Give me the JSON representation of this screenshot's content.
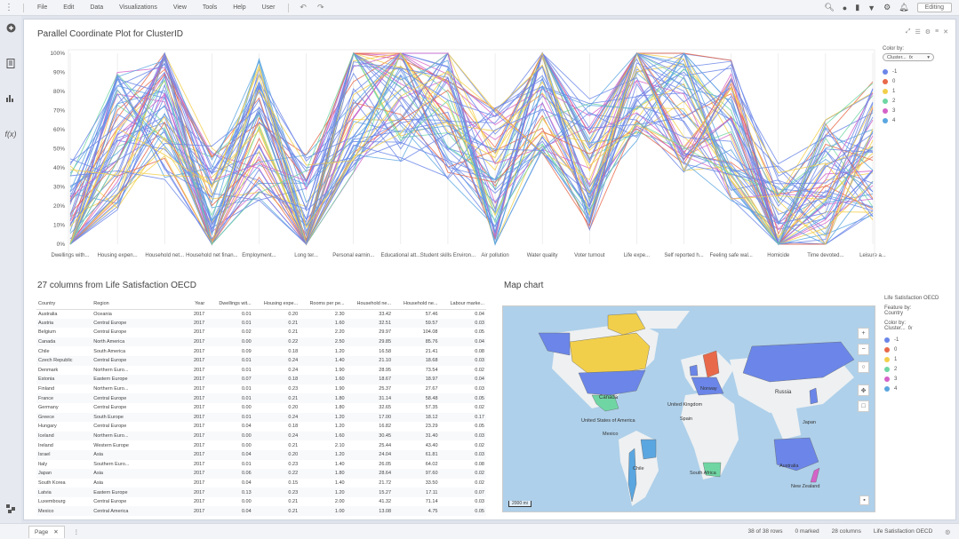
{
  "menubar": {
    "items": [
      "File",
      "Edit",
      "Data",
      "Visualizations",
      "View",
      "Tools",
      "Help",
      "User"
    ],
    "editing_label": "Editing"
  },
  "parallel_plot": {
    "title": "Parallel Coordinate Plot for ClusterID",
    "y_ticks": [
      "100%",
      "90%",
      "80%",
      "70%",
      "60%",
      "50%",
      "40%",
      "30%",
      "20%",
      "10%",
      "0%"
    ],
    "axes": [
      "Dwellings with...",
      "Housing expen...",
      "Household net...",
      "Household net finan...",
      "Employment...",
      "Long ter...",
      "Personal earnin...",
      "Educational att...",
      "Student skills Environ...",
      "Air pollution",
      "Water quality",
      "Voter turnout",
      "Life expe...",
      "Self reported h...",
      "Feeling safe wal...",
      "Homicide",
      "Time devoted...",
      "Leisure a..."
    ],
    "color_by_label": "Color by:",
    "color_by_value": "Cluster...",
    "color_by_fx": "fx",
    "legend": [
      {
        "label": "-1",
        "color": "#6b86e8"
      },
      {
        "label": "0",
        "color": "#e8684a"
      },
      {
        "label": "1",
        "color": "#f2cf4a"
      },
      {
        "label": "2",
        "color": "#6fd6a3"
      },
      {
        "label": "3",
        "color": "#d463c8"
      },
      {
        "label": "4",
        "color": "#5aa6e0"
      }
    ]
  },
  "table": {
    "title": "27 columns from Life Satisfaction OECD",
    "columns": [
      "Country",
      "Region",
      "Year",
      "Dwellings wit...",
      "Housing expe...",
      "Rooms per pe...",
      "Household ne...",
      "Household ne...",
      "Labour marke..."
    ],
    "rows": [
      [
        "Australia",
        "Oceania",
        "2017",
        "0.01",
        "0.20",
        "2.30",
        "33.42",
        "57.46",
        "0.04"
      ],
      [
        "Austria",
        "Central Europe",
        "2017",
        "0.01",
        "0.21",
        "1.60",
        "32.51",
        "59.57",
        "0.03"
      ],
      [
        "Belgium",
        "Central Europe",
        "2017",
        "0.02",
        "0.21",
        "2.20",
        "29.97",
        "104.08",
        "0.05"
      ],
      [
        "Canada",
        "North America",
        "2017",
        "0.00",
        "0.22",
        "2.50",
        "29.85",
        "85.76",
        "0.04"
      ],
      [
        "Chile",
        "South America",
        "2017",
        "0.09",
        "0.18",
        "1.20",
        "16.58",
        "21.41",
        "0.08"
      ],
      [
        "Czech Republic",
        "Central Europe",
        "2017",
        "0.01",
        "0.24",
        "1.40",
        "21.10",
        "18.68",
        "0.03"
      ],
      [
        "Denmark",
        "Northern Euro...",
        "2017",
        "0.01",
        "0.24",
        "1.90",
        "28.95",
        "73.54",
        "0.02"
      ],
      [
        "Estonia",
        "Eastern Europe",
        "2017",
        "0.07",
        "0.18",
        "1.60",
        "18.67",
        "18.97",
        "0.04"
      ],
      [
        "Finland",
        "Northern Euro...",
        "2017",
        "0.01",
        "0.23",
        "1.90",
        "25.37",
        "27.67",
        "0.03"
      ],
      [
        "France",
        "Central Europe",
        "2017",
        "0.01",
        "0.21",
        "1.80",
        "31.14",
        "58.48",
        "0.05"
      ],
      [
        "Germany",
        "Central Europe",
        "2017",
        "0.00",
        "0.20",
        "1.80",
        "32.65",
        "57.35",
        "0.02"
      ],
      [
        "Greece",
        "South Europe",
        "2017",
        "0.01",
        "0.24",
        "1.20",
        "17.00",
        "18.12",
        "0.17"
      ],
      [
        "Hungary",
        "Central Europe",
        "2017",
        "0.04",
        "0.18",
        "1.20",
        "16.82",
        "23.29",
        "0.05"
      ],
      [
        "Iceland",
        "Northern Euro...",
        "2017",
        "0.00",
        "0.24",
        "1.60",
        "30.45",
        "31.40",
        "0.03"
      ],
      [
        "Ireland",
        "Western Europe",
        "2017",
        "0.00",
        "0.21",
        "2.10",
        "25.44",
        "43.40",
        "0.02"
      ],
      [
        "Israel",
        "Asia",
        "2017",
        "0.04",
        "0.20",
        "1.20",
        "24.04",
        "61.81",
        "0.03"
      ],
      [
        "Italy",
        "Southern Euro...",
        "2017",
        "0.01",
        "0.23",
        "1.40",
        "26.05",
        "64.02",
        "0.08"
      ],
      [
        "Japan",
        "Asia",
        "2017",
        "0.06",
        "0.22",
        "1.80",
        "28.64",
        "97.60",
        "0.02"
      ],
      [
        "South Korea",
        "Asia",
        "2017",
        "0.04",
        "0.15",
        "1.40",
        "21.72",
        "33.50",
        "0.02"
      ],
      [
        "Latvia",
        "Eastern Europe",
        "2017",
        "0.13",
        "0.23",
        "1.20",
        "15.27",
        "17.11",
        "0.07"
      ],
      [
        "Luxembourg",
        "Central Europe",
        "2017",
        "0.00",
        "0.21",
        "2.00",
        "41.32",
        "71.14",
        "0.03"
      ],
      [
        "Mexico",
        "Central America",
        "2017",
        "0.04",
        "0.21",
        "1.00",
        "13.08",
        "4.75",
        "0.05"
      ]
    ]
  },
  "map": {
    "title": "Map chart",
    "layer_label": "Life Satisfaction OECD",
    "feature_by_label": "Feature by:",
    "feature_by_value": "Country",
    "color_by_label": "Color by:",
    "color_by_value": "Cluster...",
    "color_by_fx": "fx",
    "labels": [
      "Canada",
      "United States of America",
      "Norway",
      "United Kingdom",
      "Spain",
      "Russia",
      "Japan",
      "Mexico",
      "Chile",
      "South Africa",
      "Australia",
      "New Zealand"
    ],
    "scale_label": "2000 mi",
    "legend": [
      {
        "label": "-1",
        "color": "#6b86e8"
      },
      {
        "label": "0",
        "color": "#e8684a"
      },
      {
        "label": "1",
        "color": "#f2cf4a"
      },
      {
        "label": "2",
        "color": "#6fd6a3"
      },
      {
        "label": "3",
        "color": "#d463c8"
      },
      {
        "label": "4",
        "color": "#5aa6e0"
      }
    ]
  },
  "statusbar": {
    "page_tab": "Page",
    "rows": "38 of 38 rows",
    "marked": "0 marked",
    "columns": "28 columns",
    "source": "Life Satisfaction OECD"
  }
}
